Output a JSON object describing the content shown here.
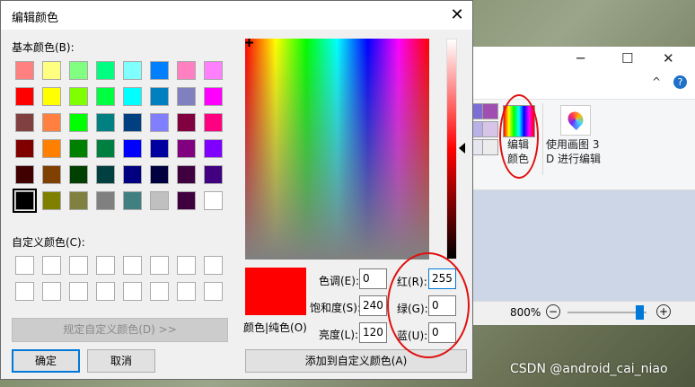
{
  "dialog": {
    "title": "编辑颜色",
    "basic_label": "基本颜色(B):",
    "custom_label": "自定义颜色(C):",
    "define_button": "规定自定义颜色(D) >>",
    "ok_button": "确定",
    "cancel_button": "取消",
    "add_button": "添加到自定义颜色(A)",
    "preview_label": "颜色|纯色(O)",
    "hue_label": "色调(E):",
    "hue_value": "0",
    "sat_label": "饱和度(S):",
    "sat_value": "240",
    "lum_label": "亮度(L):",
    "lum_value": "120",
    "red_label": "红(R):",
    "red_value": "255",
    "green_label": "绿(G):",
    "green_value": "0",
    "blue_label": "蓝(U):",
    "blue_value": "0",
    "selected_color": "#ff0000",
    "basic_colors": [
      [
        "#ff8080",
        "#ffff80",
        "#80ff80",
        "#00ff80",
        "#80ffff",
        "#0080ff",
        "#ff80c0",
        "#ff80ff"
      ],
      [
        "#ff0000",
        "#ffff00",
        "#80ff00",
        "#00ff40",
        "#00ffff",
        "#0080c0",
        "#8080c0",
        "#ff00ff"
      ],
      [
        "#804040",
        "#ff8040",
        "#00ff00",
        "#008080",
        "#004080",
        "#8080ff",
        "#800040",
        "#ff0080"
      ],
      [
        "#800000",
        "#ff8000",
        "#008000",
        "#008040",
        "#0000ff",
        "#0000a0",
        "#800080",
        "#8000ff"
      ],
      [
        "#400000",
        "#804000",
        "#004000",
        "#004040",
        "#000080",
        "#000040",
        "#400040",
        "#400080"
      ],
      [
        "#000000",
        "#808000",
        "#808040",
        "#808080",
        "#408080",
        "#c0c0c0",
        "#400040",
        "#ffffff"
      ]
    ]
  },
  "paint": {
    "edit_colors_label": "编辑\n颜色",
    "paint3d_label": "使用画图 3\nD 进行编辑",
    "zoom_label": "800%",
    "zoom_out": "−",
    "zoom_in": "+",
    "help_icon": "?",
    "ribbon_caret": "^",
    "minimize": "─",
    "maximize": "☐",
    "close": "✕"
  },
  "watermark": "CSDN @android_cai_niao"
}
